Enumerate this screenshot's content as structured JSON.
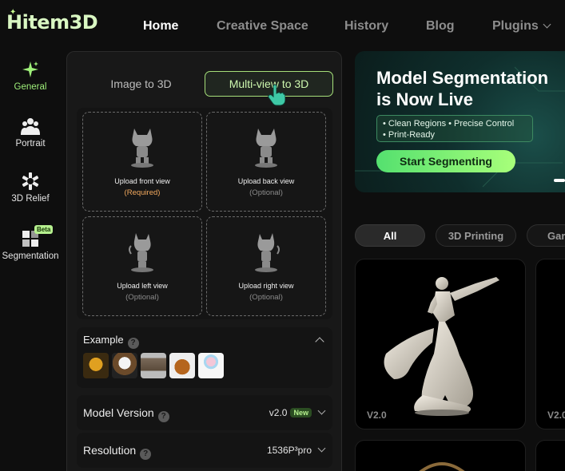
{
  "app": {
    "logo_text": "Hitem3D"
  },
  "nav": {
    "items": [
      {
        "label": "Home",
        "active": true
      },
      {
        "label": "Creative Space"
      },
      {
        "label": "History"
      },
      {
        "label": "Blog"
      },
      {
        "label": "Plugins"
      }
    ]
  },
  "rail": {
    "items": [
      {
        "label": "General",
        "icon": "sparkle-icon",
        "active": true
      },
      {
        "label": "Portrait",
        "icon": "people-icon"
      },
      {
        "label": "3D Relief",
        "icon": "relief-icon"
      },
      {
        "label": "Segmentation",
        "icon": "segmentation-icon",
        "badge": "Beta"
      }
    ]
  },
  "panel": {
    "tabs": [
      {
        "label": "Image to 3D"
      },
      {
        "label": "Multi-view to 3D",
        "active": true
      }
    ],
    "uploads": [
      {
        "title": "Upload front view",
        "note": "(Required)"
      },
      {
        "title": "Upload back view",
        "note": "(Optional)"
      },
      {
        "title": "Upload left view",
        "note": "(Optional)"
      },
      {
        "title": "Upload right view",
        "note": "(Optional)"
      }
    ],
    "example": {
      "title": "Example",
      "help": "?"
    },
    "settings": [
      {
        "label": "Model Version",
        "value": "v2.0",
        "badge": "New"
      },
      {
        "label": "Resolution",
        "value": "1536P³pro"
      }
    ]
  },
  "banner": {
    "title_line1": "Model Segmentation",
    "title_line2": "is Now Live",
    "feature_line1": "• Clean Regions  • Precise Control",
    "feature_line2": "• Print-Ready",
    "cta": "Start Segmenting"
  },
  "filters": [
    {
      "label": "All",
      "active": true
    },
    {
      "label": "3D Printing"
    },
    {
      "label": "Gar"
    }
  ],
  "gallery": [
    {
      "version": "V2.0"
    },
    {
      "version": "V2.0"
    }
  ],
  "colors": {
    "accent": "#a6ec7b",
    "required": "#f2a95e",
    "background": "#0e0e0e"
  }
}
